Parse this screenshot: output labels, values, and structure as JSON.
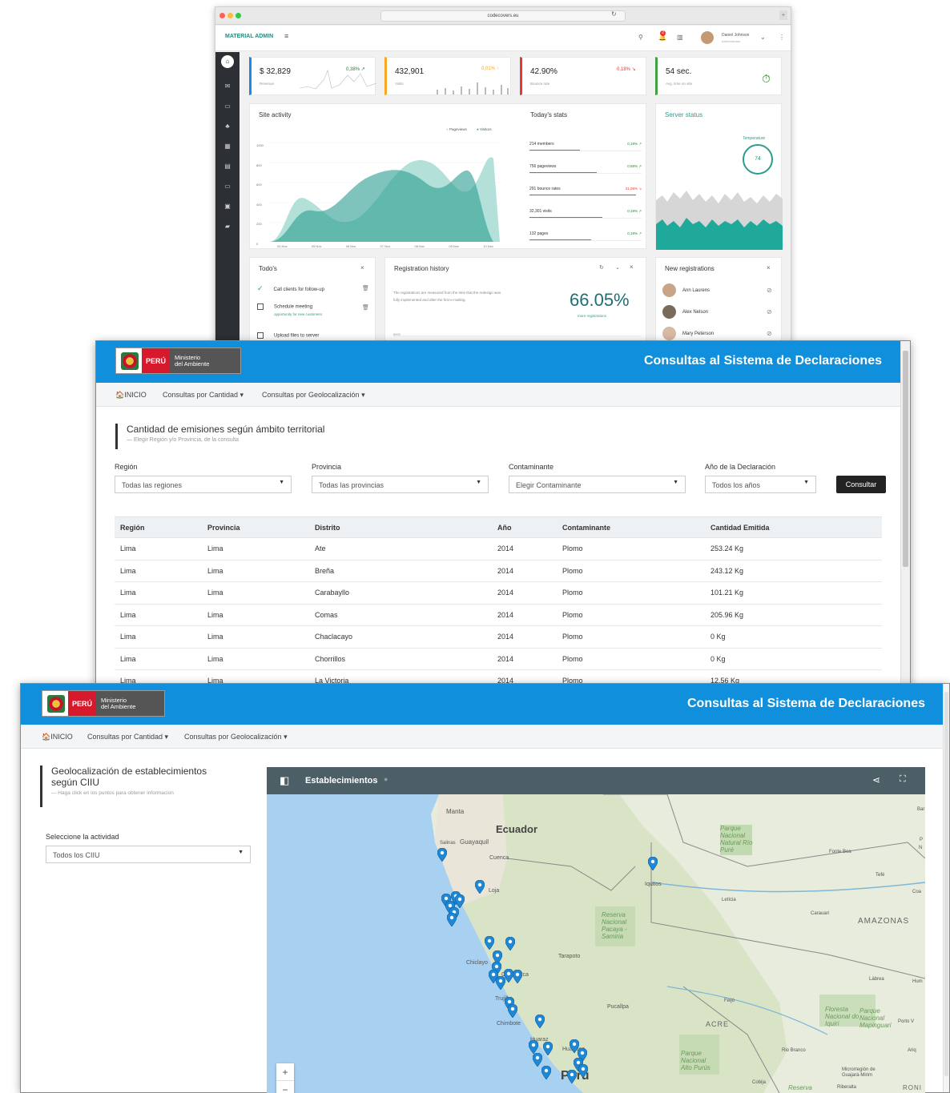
{
  "admin": {
    "url": "codecovers.eu",
    "brand": "MATERIAL ADMIN",
    "user": {
      "name": "Daniel Johnson",
      "role": "Administrator"
    },
    "kpis": [
      {
        "value": "$ 32,829",
        "label": "Revenue",
        "pct": "0,38% ↗",
        "color": "#2e7d32",
        "accent": "#1e88e5"
      },
      {
        "value": "432,901",
        "label": "Visits",
        "pct": "0,01% ↑",
        "color": "#f9a825",
        "accent": "#f9a825"
      },
      {
        "value": "42.90%",
        "label": "Bounce rate",
        "pct": "0,18% ↘",
        "color": "#e53935",
        "accent": "#e53935"
      },
      {
        "value": "54 sec.",
        "label": "Avg. time on site",
        "pct": "⏱",
        "color": "#2e7d32",
        "accent": "#43a047"
      }
    ],
    "site_activity": {
      "title": "Site activity",
      "legend": [
        "Pageviews",
        "Visitors"
      ],
      "y_ticks": [
        "1000",
        "800",
        "600",
        "400",
        "200",
        "0"
      ],
      "x_ticks": [
        "04 Nov",
        "05 Nov",
        "06 Nov",
        "07 Nov",
        "08 Nov",
        "09 Nov",
        "10 Nov"
      ]
    },
    "todays_stats": {
      "title": "Today's stats",
      "rows": [
        {
          "label": "214 members",
          "value": "0,18% ↗",
          "color": "#2e7d32",
          "fill": 0.45
        },
        {
          "label": "756 pageviews",
          "value": "0,68% ↗",
          "color": "#2e7d32",
          "fill": 0.6
        },
        {
          "label": "291 bounce rates",
          "value": "21,08% ↘",
          "color": "#e53935",
          "fill": 0.95
        },
        {
          "label": "32,301 visits",
          "value": "0,18% ↗",
          "color": "#2e7d32",
          "fill": 0.65
        },
        {
          "label": "132 pages",
          "value": "0,18% ↗",
          "color": "#2e7d32",
          "fill": 0.55
        }
      ]
    },
    "server": {
      "title": "Server status",
      "gauge_label": "Temperature",
      "gauge_value": "74"
    },
    "todos": {
      "title": "Todo's",
      "items": [
        {
          "label": "Call clients for follow-up",
          "sub": ""
        },
        {
          "label": "Schedule meeting",
          "sub": "opportunity for new customers"
        },
        {
          "label": "Upload files to server",
          "sub": ""
        }
      ]
    },
    "registration": {
      "title": "Registration history",
      "note": "The registrations are measured from the time that the redesign was fully implemented and after the first e-mailing.",
      "value": "66.05%",
      "more": "more registrations",
      "axis_tick": "8000"
    },
    "new_regs": {
      "title": "New registrations",
      "people": [
        "Ann Laurens",
        "Alex Nelson",
        "Mary Peterson"
      ]
    }
  },
  "peru": {
    "logo_peru": "PERÚ",
    "logo_ministry_1": "Ministerio",
    "logo_ministry_2": "del Ambiente",
    "title": "Consultas al Sistema de Declaraciones",
    "nav": {
      "home": "INICIO",
      "cantidad": "Consultas por Cantidad ▾",
      "geo": "Consultas por Geolocalización ▾"
    }
  },
  "emissions": {
    "title": "Cantidad de emisiones según ámbito territorial",
    "subtitle": "— Elegir Región y/o Provincia, de la consulta",
    "filters": [
      {
        "label": "Región",
        "value": "Todas las regiones"
      },
      {
        "label": "Provincia",
        "value": "Todas las provincias"
      },
      {
        "label": "Contaminante",
        "value": "Elegir Contaminante"
      },
      {
        "label": "Año de la Declaración",
        "value": "Todos los años"
      }
    ],
    "button": "Consultar",
    "columns": [
      "Región",
      "Provincia",
      "Distrito",
      "Año",
      "Contaminante",
      "Cantidad Emitida"
    ],
    "rows": [
      [
        "Lima",
        "Lima",
        "Ate",
        "2014",
        "Plomo",
        "253.24 Kg"
      ],
      [
        "Lima",
        "Lima",
        "Breña",
        "2014",
        "Plomo",
        "243.12 Kg"
      ],
      [
        "Lima",
        "Lima",
        "Carabayllo",
        "2014",
        "Plomo",
        "101.21 Kg"
      ],
      [
        "Lima",
        "Lima",
        "Comas",
        "2014",
        "Plomo",
        "205.96 Kg"
      ],
      [
        "Lima",
        "Lima",
        "Chaclacayo",
        "2014",
        "Plomo",
        "0 Kg"
      ],
      [
        "Lima",
        "Lima",
        "Chorrillos",
        "2014",
        "Plomo",
        "0 Kg"
      ],
      [
        "Lima",
        "Lima",
        "La Victoria",
        "2014",
        "Plomo",
        "12.56 Kg"
      ]
    ]
  },
  "geo": {
    "title_1": "Geolocalización de establecimientos",
    "title_2": "según CIIU",
    "subtitle": "— Haga click en los puntos para obtener informacion",
    "activity_label": "Seleccione la actividad",
    "activity_value": "Todos los CIIU",
    "map_title": "Establecimientos",
    "map_labels": [
      "Manta",
      "Ecuador",
      "Guayaquil",
      "Salinas",
      "Cuenca",
      "Loja",
      "Iquitos",
      "Parque Nacional Natural Río Puré",
      "Fonte Boa",
      "Tefé",
      "Coa",
      "Carauari",
      "AMAZONAS",
      "Reserva Nacional Pacaya - Samiria",
      "Tarapoto",
      "Chiclayo",
      "Cajamarca",
      "Trujillo",
      "Chimbote",
      "Huaraz",
      "Huánuco",
      "Pucallpa",
      "Feijó",
      "ACRE",
      "Lábrea",
      "Floresta Nacional do Iquiri",
      "Parque Nacional Mapinguari",
      "Porto V",
      "Rio Branco",
      "Parque Nacional Alto Purús",
      "Perú",
      "Reserva",
      "Riberalta",
      "Microrregión de Guajará-Mirim",
      "Cobija",
      "Ariq",
      "Hum",
      "Bar",
      "N",
      "P",
      "Letícia",
      "RONI"
    ]
  }
}
